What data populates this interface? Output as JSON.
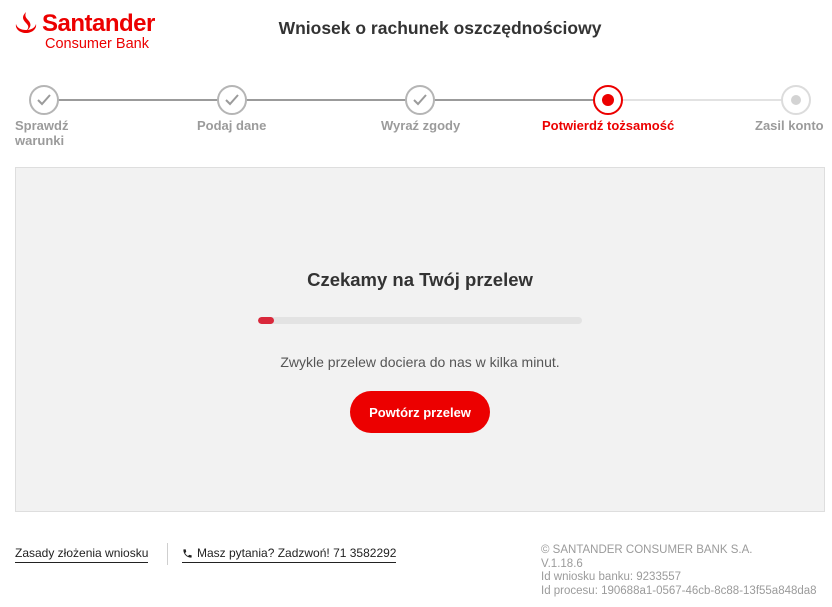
{
  "brand": {
    "name": "Santander",
    "sub": "Consumer Bank",
    "color": "#ec0000"
  },
  "header": {
    "title": "Wniosek o rachunek oszczędnościowy"
  },
  "stepper": {
    "steps": [
      {
        "label": "Sprawdź warunki",
        "state": "done"
      },
      {
        "label": "Podaj dane",
        "state": "done"
      },
      {
        "label": "Wyraź zgody",
        "state": "done"
      },
      {
        "label": "Potwierdź tożsamość",
        "state": "active"
      },
      {
        "label": "Zasil konto",
        "state": "todo"
      }
    ]
  },
  "main": {
    "title": "Czekamy na Twój przelew",
    "progress_percent": 5,
    "description": "Zwykle przelew dociera do nas w kilka minut.",
    "retry_label": "Powtórz przelew"
  },
  "footer": {
    "rules_link": "Zasady złożenia wniosku",
    "phone_link": "Masz pytania? Zadzwoń! 71 3582292",
    "copyright": "© SANTANDER CONSUMER BANK S.A.",
    "version": "V.1.18.6",
    "bank_id": "Id wniosku banku: 9233557",
    "process_id": "Id procesu: 190688a1-0567-46cb-8c88-13f55a848da8"
  },
  "icons": [
    "santander-flame-icon",
    "check-icon",
    "phone-icon"
  ]
}
